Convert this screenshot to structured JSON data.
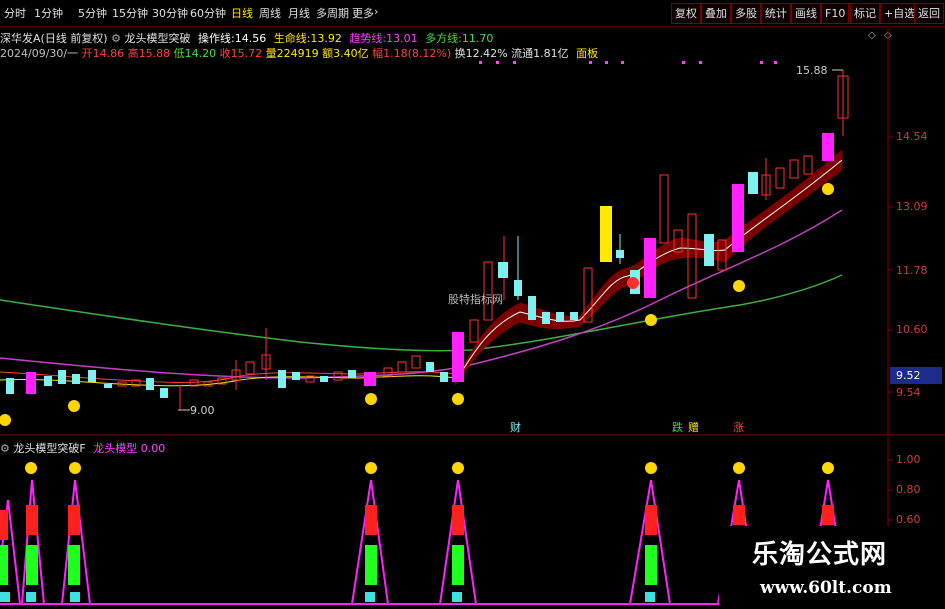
{
  "toolbar": {
    "periods": [
      "分时",
      "1分钟",
      "5分钟",
      "15分钟",
      "30分钟",
      "60分钟",
      "日线",
      "周线",
      "月线",
      "多周期",
      "更多"
    ],
    "more_arrow": "›",
    "right_buttons": [
      "复权",
      "叠加",
      "多股",
      "统计",
      "画线",
      "F10",
      "标记",
      "+自选",
      "返回"
    ]
  },
  "info": {
    "stock_line": "深华发A(日线 前复权)",
    "indicator_name": "龙头模型突破",
    "op_label": "操作线:",
    "op_value": "14.56",
    "life_label": "生命线:",
    "life_value": "13.92",
    "trend_label": "趋势线:",
    "trend_value": "13.01",
    "bull_label": "多方线:",
    "bull_value": "11.70",
    "date": "2024/09/30/一",
    "open_label": "开",
    "open_value": "14.86",
    "high_label": "高",
    "high_value": "15.88",
    "low_label": "低",
    "low_value": "14.20",
    "close_label": "收",
    "close_value": "15.72",
    "vol_label": "量",
    "vol_value": "224919",
    "amt_label": "额",
    "amt_value": "3.40亿",
    "chg_label": "幅",
    "chg_value": "1.18(8.12%)",
    "turn_label": "换",
    "turn_value": "12.42%",
    "float_label": "流通",
    "float_value": "1.81亿",
    "panel_label": "面板"
  },
  "price_axis": {
    "labels": [
      "14.54",
      "13.09",
      "11.78",
      "10.60",
      "9.54"
    ],
    "current_price": "9.52",
    "high_mark": "15.88",
    "low_mark": "9.00"
  },
  "chart_annotations": {
    "watermark_text": "股特指标网",
    "markers": [
      "财",
      "跌",
      "赠",
      "涨"
    ]
  },
  "indicator": {
    "title": "龙头模型突破F",
    "series_name": "龙头模型",
    "series_value": "0.00",
    "axis_labels": [
      "1.00",
      "0.80",
      "0.60"
    ]
  },
  "watermark": {
    "title": "乐淘公式网",
    "url": "www.60lt.com"
  },
  "colors": {
    "up": "#ff3030",
    "down": "#7ff0f0",
    "signal": "#ff22ff",
    "yellow_bar": "#ffea00",
    "green_line": "#40c040",
    "purple_line": "#c040c0",
    "band": "#7a0000"
  }
}
